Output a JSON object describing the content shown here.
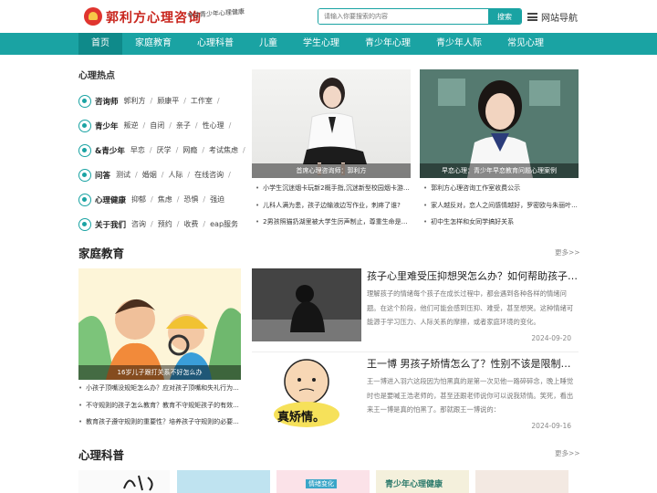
{
  "header": {
    "logo_text": "郭利方心理咨询",
    "slogan": "专注青少年心理健康",
    "search_placeholder": "请输入你要搜索的内容",
    "search_button": "搜索",
    "site_nav": "网站导航"
  },
  "nav": [
    "首页",
    "家庭教育",
    "心理科普",
    "儿童",
    "学生心理",
    "青少年心理",
    "青少年人际",
    "常见心理"
  ],
  "hot": {
    "title": "心理热点",
    "rows": [
      {
        "cat": "咨询师",
        "links": [
          "郭利方",
          "顾康平",
          "工作室"
        ],
        "icon": "consultant-icon"
      },
      {
        "cat": "青少年",
        "links": [
          "叛逆",
          "自闭",
          "亲子",
          "性心理"
        ],
        "icon": "youth-icon"
      },
      {
        "cat": "&青少年",
        "links": [
          "早恋",
          "厌学",
          "网瘾",
          "考试焦虑"
        ],
        "icon": "teen-icon"
      },
      {
        "cat": "问答",
        "links": [
          "测试",
          "婚姻",
          "人际",
          "在线咨询"
        ],
        "icon": "qa-icon"
      },
      {
        "cat": "心理健康",
        "links": [
          "抑郁",
          "焦虑",
          "恐惧",
          "强迫"
        ],
        "icon": "health-icon"
      },
      {
        "cat": "关于我们",
        "links": [
          "咨询",
          "预约",
          "收费",
          "eap服务"
        ],
        "icon": "about-icon"
      }
    ]
  },
  "featured": [
    {
      "caption": "首席心理咨询师：郭利方"
    },
    {
      "caption": "早恋心理：青少年早恋教育问题心理案例"
    }
  ],
  "news_left": [
    "小学生沉迷烟卡玩新2概手指,沉迷新型校园烟卡游戏...",
    "儿科人满为患，孩子边输液边写作业，刺疼了谁?",
    "2男孩照猫扔湖里被大学生厉声制止，尊重生命是孩..."
  ],
  "news_right": [
    "郭利方心理咨询工作室收费公示",
    "家人越反对，恋人之间感情越好，罗密欧与朱丽叶...",
    "初中生怎样和女同学搞好关系"
  ],
  "family": {
    "title": "家庭教育",
    "more": "更多>>",
    "feature_caption": "16岁儿子跟打关系不好怎么办",
    "list": [
      "小孩子顶嘴没规矩怎么办？应对孩子顶嘴和失礼行为...",
      "不守规则的孩子怎么教育？教育不守规矩孩子的有效...",
      "教育孩子遵守规则的重要性？培养孩子守规则的必要..."
    ],
    "articles": [
      {
        "title": "孩子心里难受压抑想哭怎么办？如何帮助孩子排解压抑情绪",
        "desc": "理解孩子的情绪每个孩子在成长过程中，都会遇到各种各样的情绪问题。在这个阶段，他们可能会感到压抑、难受，甚至想哭。这种情绪可能源于学习压力、人际关系的摩擦，或者家庭环境的变化。",
        "date": "2024-09-20"
      },
      {
        "title": "王一博 男孩子矫情怎么了？性别不该是限制情感的理由",
        "desc": "王一博进入羽六这段因为怕黑真的是第一次见他一路碎碎念，晚上睡觉时也是要喊王浩老师的，甚至还跟老师说你可以说我矫情。笑死，看出来王一博是真的怕黑了。那就跟王一博说的：",
        "date": "2024-09-16",
        "img_text": "真矫情。"
      }
    ]
  },
  "science": {
    "title": "心理科普",
    "more": "更多>>",
    "thumbs": [
      "情绪变化",
      "青少年心理健康"
    ]
  }
}
